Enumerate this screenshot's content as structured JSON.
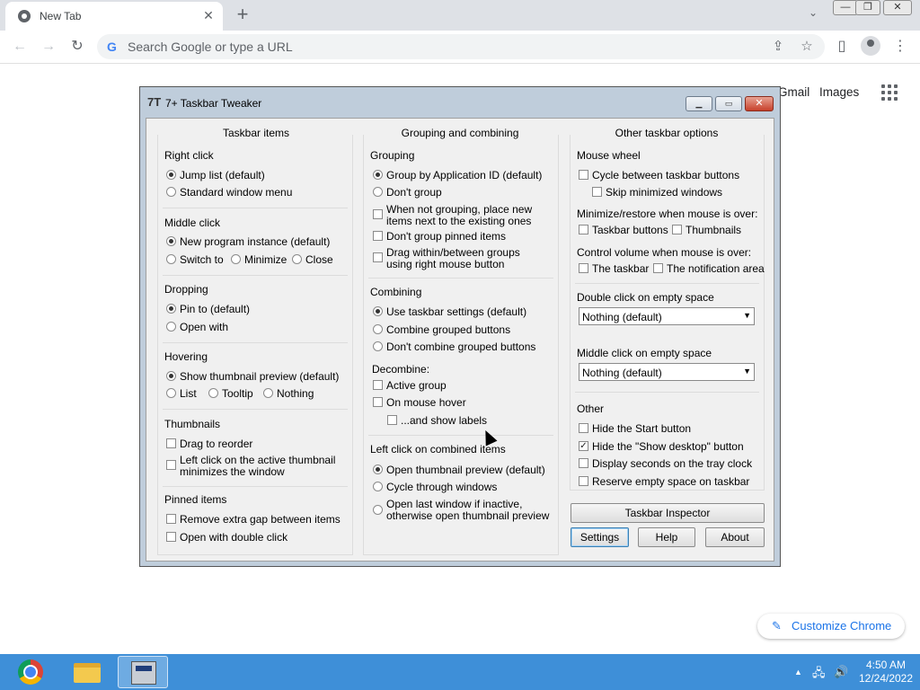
{
  "chrome": {
    "tab_title": "New Tab",
    "tab_close": "✕",
    "new_tab": "+",
    "tab_search": "⌄",
    "window_minimize": "—",
    "window_restore": "❐",
    "window_close": "✕",
    "back": "←",
    "forward": "→",
    "reload": "↻",
    "omnibox_placeholder": "Search Google or type a URL",
    "share": "⇪",
    "bookmark": "☆",
    "sidepanel": "▯",
    "menu": "⋮",
    "ntp_links": [
      "Gmail",
      "Images"
    ],
    "customize_label": "Customize Chrome",
    "customize_icon": "✎"
  },
  "tweaker": {
    "app_icon": "7T",
    "title": "7+ Taskbar Tweaker",
    "caption": {
      "minimize": "▁",
      "maximize": "▭",
      "close": "✕"
    },
    "col1": {
      "title": "Taskbar items",
      "right_click": {
        "title": "Right click",
        "options": [
          {
            "label": "Jump list (default)",
            "checked": true
          },
          {
            "label": "Standard window menu",
            "checked": false
          }
        ]
      },
      "middle_click": {
        "title": "Middle click",
        "options": [
          {
            "label": "New program instance (default)",
            "checked": true
          },
          {
            "label": "Switch to",
            "checked": false
          },
          {
            "label": "Minimize",
            "checked": false
          },
          {
            "label": "Close",
            "checked": false
          }
        ]
      },
      "dropping": {
        "title": "Dropping",
        "options": [
          {
            "label": "Pin to (default)",
            "checked": true
          },
          {
            "label": "Open with",
            "checked": false
          }
        ]
      },
      "hovering": {
        "title": "Hovering",
        "options": [
          {
            "label": "Show thumbnail preview (default)",
            "checked": true
          },
          {
            "label": "List",
            "checked": false
          },
          {
            "label": "Tooltip",
            "checked": false
          },
          {
            "label": "Nothing",
            "checked": false
          }
        ]
      },
      "thumbnails": {
        "title": "Thumbnails",
        "options": [
          {
            "label": "Drag to reorder",
            "checked": false
          },
          {
            "label_line1": "Left click on the active thumbnail",
            "label_line2": "minimizes the window",
            "checked": false
          }
        ]
      },
      "pinned": {
        "title": "Pinned items",
        "options": [
          {
            "label": "Remove extra gap between items",
            "checked": false
          },
          {
            "label": "Open with double click",
            "checked": false
          }
        ]
      }
    },
    "col2": {
      "title": "Grouping and combining",
      "grouping": {
        "title": "Grouping",
        "radios": [
          {
            "label": "Group by Application ID (default)",
            "checked": true
          },
          {
            "label": "Don't group",
            "checked": false
          }
        ],
        "checks": [
          {
            "label_line1": "When not grouping, place new",
            "label_line2": "items next to the existing ones",
            "checked": false
          },
          {
            "label": "Don't group pinned items",
            "checked": false
          },
          {
            "label_line1": "Drag within/between groups",
            "label_line2": "using right mouse button",
            "checked": false
          }
        ]
      },
      "combining": {
        "title": "Combining",
        "options": [
          {
            "label": "Use taskbar settings (default)",
            "checked": true
          },
          {
            "label": "Combine grouped buttons",
            "checked": false
          },
          {
            "label": "Don't combine grouped buttons",
            "checked": false
          }
        ]
      },
      "decombine": {
        "title": "Decombine:",
        "options": [
          {
            "label": "Active group",
            "checked": false
          },
          {
            "label": "On mouse hover",
            "checked": false
          },
          {
            "label": "...and show labels",
            "checked": false
          }
        ]
      },
      "left_click": {
        "title": "Left click on combined items",
        "options": [
          {
            "label": "Open thumbnail preview (default)",
            "checked": true
          },
          {
            "label": "Cycle through windows",
            "checked": false
          },
          {
            "label_line1": "Open last window if inactive,",
            "label_line2": "otherwise open thumbnail preview",
            "checked": false
          }
        ]
      }
    },
    "col3": {
      "title": "Other taskbar options",
      "mouse_wheel": {
        "title": "Mouse wheel",
        "options": [
          {
            "label": "Cycle between taskbar buttons",
            "checked": false
          },
          {
            "label": "Skip minimized windows",
            "checked": false
          }
        ]
      },
      "minimize_restore": {
        "title": "Minimize/restore when mouse is over:",
        "options": [
          {
            "label": "Taskbar buttons",
            "checked": false
          },
          {
            "label": "Thumbnails",
            "checked": false
          }
        ]
      },
      "volume": {
        "title": "Control volume when mouse is over:",
        "options": [
          {
            "label": "The taskbar",
            "checked": false
          },
          {
            "label": "The notification area",
            "checked": false
          }
        ]
      },
      "double_click": {
        "title": "Double click on empty space",
        "value": "Nothing (default)"
      },
      "middle_click_empty": {
        "title": "Middle click on empty space",
        "value": "Nothing (default)"
      },
      "other": {
        "title": "Other",
        "options": [
          {
            "label": "Hide the Start button",
            "checked": false
          },
          {
            "label": "Hide the \"Show desktop\" button",
            "checked": true
          },
          {
            "label": "Display seconds on the tray clock",
            "checked": false
          },
          {
            "label": "Reserve empty space on taskbar",
            "checked": false
          }
        ]
      }
    },
    "buttons": {
      "inspector": "Taskbar Inspector",
      "settings": "Settings",
      "help": "Help",
      "about": "About"
    }
  },
  "taskbar": {
    "apps": [
      "chrome-icon",
      "folder-icon",
      "taskbar-tweaker-icon"
    ],
    "tray_arrow": "▲",
    "network_icon": "🖧",
    "volume_icon": "🔊",
    "time": "4:50 AM",
    "date": "12/24/2022"
  }
}
